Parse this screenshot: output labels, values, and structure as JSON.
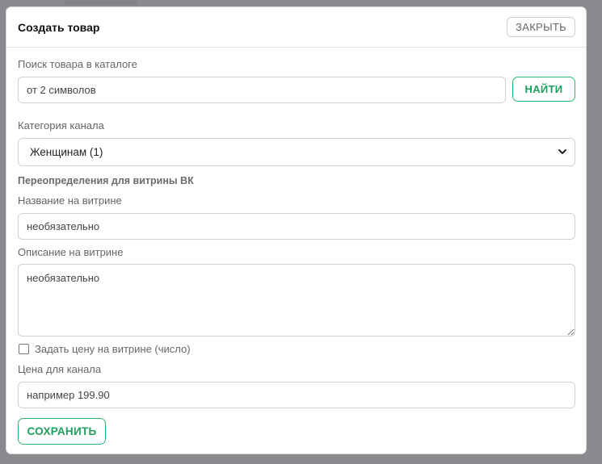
{
  "modal": {
    "title": "Создать товар",
    "close_label": "ЗАКРЫТЬ"
  },
  "search": {
    "label": "Поиск товара в каталоге",
    "placeholder": "от 2 символов",
    "button_label": "НАЙТИ"
  },
  "category": {
    "label": "Категория канала",
    "selected": "Женщинам (1)"
  },
  "vk_overrides": {
    "section_title": "Переопределения для витрины ВК",
    "name_label": "Название на витрине",
    "name_placeholder": "необязательно",
    "description_label": "Описание на витрине",
    "description_placeholder": "необязательно",
    "price_checkbox_label": "Задать цену на витрине (число)",
    "price_checked": false
  },
  "price": {
    "label": "Цена для канала",
    "placeholder": "например 199.90"
  },
  "save_label": "СОХРАНИТЬ",
  "colors": {
    "accent": "#2bb673",
    "backdrop": "#8a8a8e"
  },
  "icons": {
    "select": "chevron-down-icon"
  }
}
